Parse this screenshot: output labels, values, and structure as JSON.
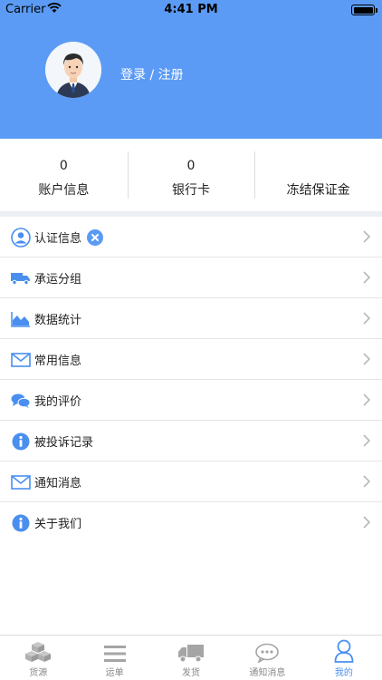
{
  "status_bar": {
    "carrier": "Carrier",
    "time": "4:41 PM"
  },
  "header": {
    "login_label": "登录 / 注册"
  },
  "stats": [
    {
      "value": "0",
      "label": "账户信息"
    },
    {
      "value": "0",
      "label": "银行卡"
    },
    {
      "value": "",
      "label": "冻结保证金"
    }
  ],
  "menu": [
    {
      "label": "认证信息",
      "icon": "user-circle-icon"
    },
    {
      "label": "承运分组",
      "icon": "truck-icon"
    },
    {
      "label": "数据统计",
      "icon": "area-chart-icon"
    },
    {
      "label": "常用信息",
      "icon": "envelope-icon"
    },
    {
      "label": "我的评价",
      "icon": "chat-bubbles-icon"
    },
    {
      "label": "被投诉记录",
      "icon": "info-circle-icon"
    },
    {
      "label": "通知消息",
      "icon": "envelope-icon"
    },
    {
      "label": "关于我们",
      "icon": "info-circle-icon"
    }
  ],
  "tabs": [
    {
      "label": "货源",
      "icon": "boxes-icon"
    },
    {
      "label": "运单",
      "icon": "list-icon"
    },
    {
      "label": "发货",
      "icon": "truck-icon"
    },
    {
      "label": "通知消息",
      "icon": "chat-icon"
    },
    {
      "label": "我的",
      "icon": "user-icon",
      "active": true
    }
  ],
  "colors": {
    "accent": "#5b9bf5",
    "tab_active": "#4a8ff0",
    "icon_blue": "#4a8ff0"
  }
}
